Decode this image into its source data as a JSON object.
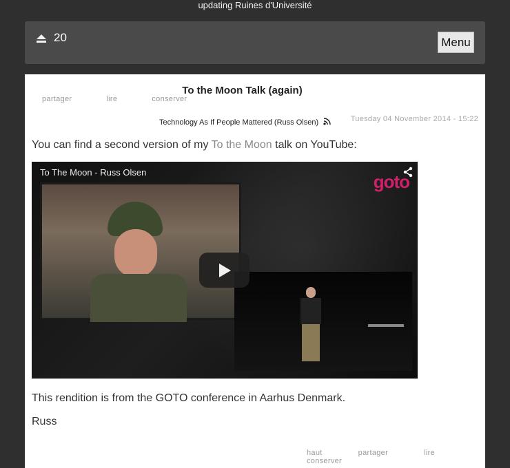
{
  "status": {
    "text": "updating Ruines d'Université"
  },
  "topbar": {
    "count": "20",
    "menu_label": "Menu",
    "eject_icon": "eject-icon"
  },
  "post": {
    "share_actions": [
      "partager",
      "lire",
      "conserver"
    ],
    "title": "To the Moon Talk (again)",
    "feed_name": "Technology As If People Mattered (Russ Olsen)",
    "date": "Tuesday 04 November 2014 - 15:22",
    "intro_before": "You can find a second version of my ",
    "intro_link": "To the Moon",
    "intro_after": " talk on YouTube:",
    "video_title": "To The Moon - Russ Olsen",
    "video_logo": "goto",
    "paragraph_1": "This rendition is from the GOTO conference in Aarhus Denmark.",
    "paragraph_2": "Russ",
    "footer_actions": [
      "haut",
      "partager",
      "lire",
      "conserver"
    ]
  },
  "colors": {
    "page_bg": "#2f2f2f",
    "bar_bg": "#4a4a4a",
    "logo": "#d0206c"
  }
}
